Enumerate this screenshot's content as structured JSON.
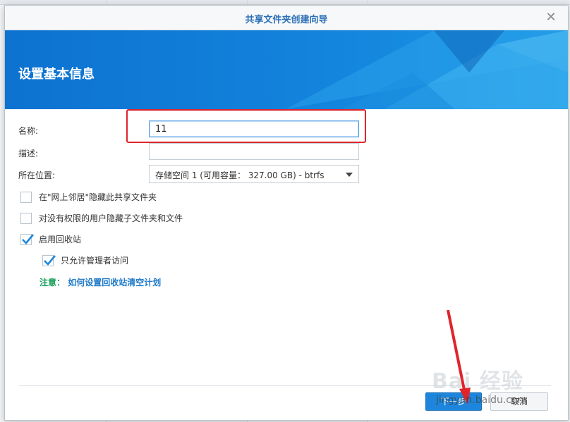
{
  "dialog": {
    "title": "共享文件夹创建向导",
    "close_glyph": "✕",
    "banner_title": "设置基本信息"
  },
  "form": {
    "name_label": "名称:",
    "name_value": "11",
    "description_label": "描述:",
    "description_value": "",
    "location_label": "所在位置:",
    "location_value": "存储空间 1 (可用容量： 327.00 GB) - btrfs"
  },
  "options": [
    {
      "label": "在\"网上邻居\"隐藏此共享文件夹",
      "checked": false
    },
    {
      "label": "对没有权限的用户隐藏子文件夹和文件",
      "checked": false
    },
    {
      "label": "启用回收站",
      "checked": true
    },
    {
      "label": "只允许管理者访问",
      "checked": true
    }
  ],
  "note": {
    "prefix": "注意：",
    "link": "如何设置回收站清空计划"
  },
  "buttons": {
    "next": "下一步",
    "cancel": "取消"
  },
  "watermark": {
    "main": "Bai 经验",
    "sub": "jingyan.baidu.com"
  },
  "colors": {
    "accent": "#1d86dc",
    "title": "#2a6fb5",
    "highlight": "#e0242a",
    "note_prefix": "#18a05a",
    "note_link": "#1f7ac9"
  }
}
